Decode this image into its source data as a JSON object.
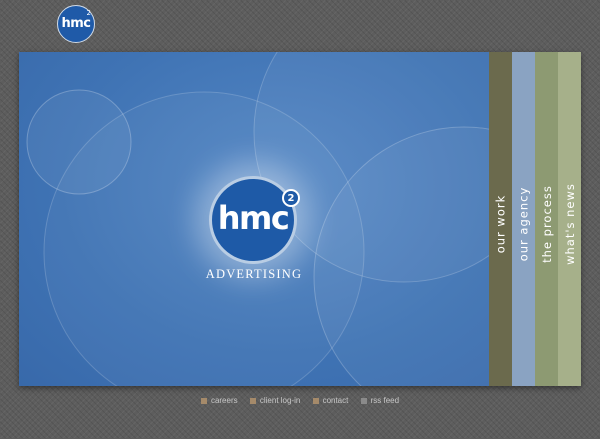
{
  "brand": {
    "logo_text": "hmc",
    "logo_superscript": "2",
    "tagline": "ADVERTISING"
  },
  "nav": [
    {
      "label": "our work",
      "color": "#6b6a4d"
    },
    {
      "label": "our agency",
      "color": "#8aa3c2"
    },
    {
      "label": "the process",
      "color": "#8d9a72"
    },
    {
      "label": "what's news",
      "color": "#a6b08a"
    }
  ],
  "footer": [
    {
      "label": "careers",
      "icon": "square-bullet-icon",
      "color": "#a58a6a"
    },
    {
      "label": "client log-in",
      "icon": "square-bullet-icon",
      "color": "#a58a6a"
    },
    {
      "label": "contact",
      "icon": "square-bullet-icon",
      "color": "#a58a6a"
    },
    {
      "label": "rss feed",
      "icon": "rss-icon",
      "color": "#8a8a8a"
    }
  ],
  "colors": {
    "hero_blue": "#3f73b4",
    "logo_blue": "#1e5aa7",
    "background": "#5d5d5d"
  }
}
